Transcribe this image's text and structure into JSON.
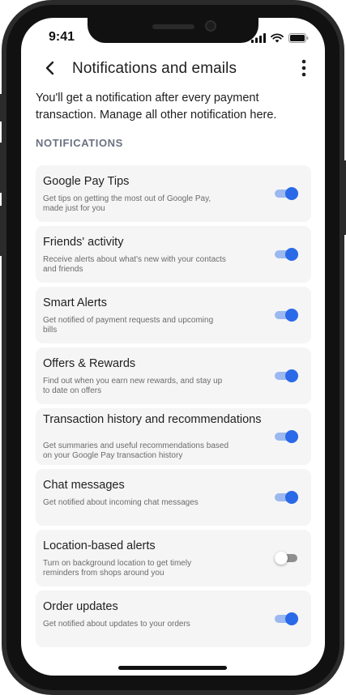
{
  "status_bar": {
    "time": "9:41",
    "icons": [
      "signal-icon",
      "wifi-icon",
      "battery-icon"
    ]
  },
  "app_bar": {
    "title": "Notifications and emails",
    "back_icon": "back-arrow-icon",
    "more_icon": "more-vert-icon"
  },
  "intro_text": "You'll get a notification after every payment transaction. Manage all other notification here.",
  "section_header": "NOTIFICATIONS",
  "colors": {
    "accent": "#2a6ae8",
    "accent_track": "#9bb8f0",
    "card_bg": "#f5f5f5",
    "section_header": "#6b7280"
  },
  "notifications": [
    {
      "title": "Google Pay Tips",
      "description": "Get tips on getting the most out of Google Pay, made just for you",
      "enabled": true
    },
    {
      "title": "Friends' activity",
      "description": "Receive alerts about what's new with your contacts and friends",
      "enabled": true
    },
    {
      "title": "Smart Alerts",
      "description": "Get notified of payment requests and upcoming bills",
      "enabled": true
    },
    {
      "title": "Offers & Rewards",
      "description": "Find out when you earn new rewards, and stay up to date on offers",
      "enabled": true
    },
    {
      "title": "Transaction history and recommendations",
      "description": "Get summaries and useful recommendations based on your Google Pay transaction history",
      "enabled": true
    },
    {
      "title": "Chat messages",
      "description": "Get notified about incoming chat messages",
      "enabled": true
    },
    {
      "title": "Location-based alerts",
      "description": "Turn on background location to get timely reminders from shops around you",
      "enabled": false
    },
    {
      "title": "Order updates",
      "description": "Get notified about updates to your orders",
      "enabled": true
    }
  ]
}
